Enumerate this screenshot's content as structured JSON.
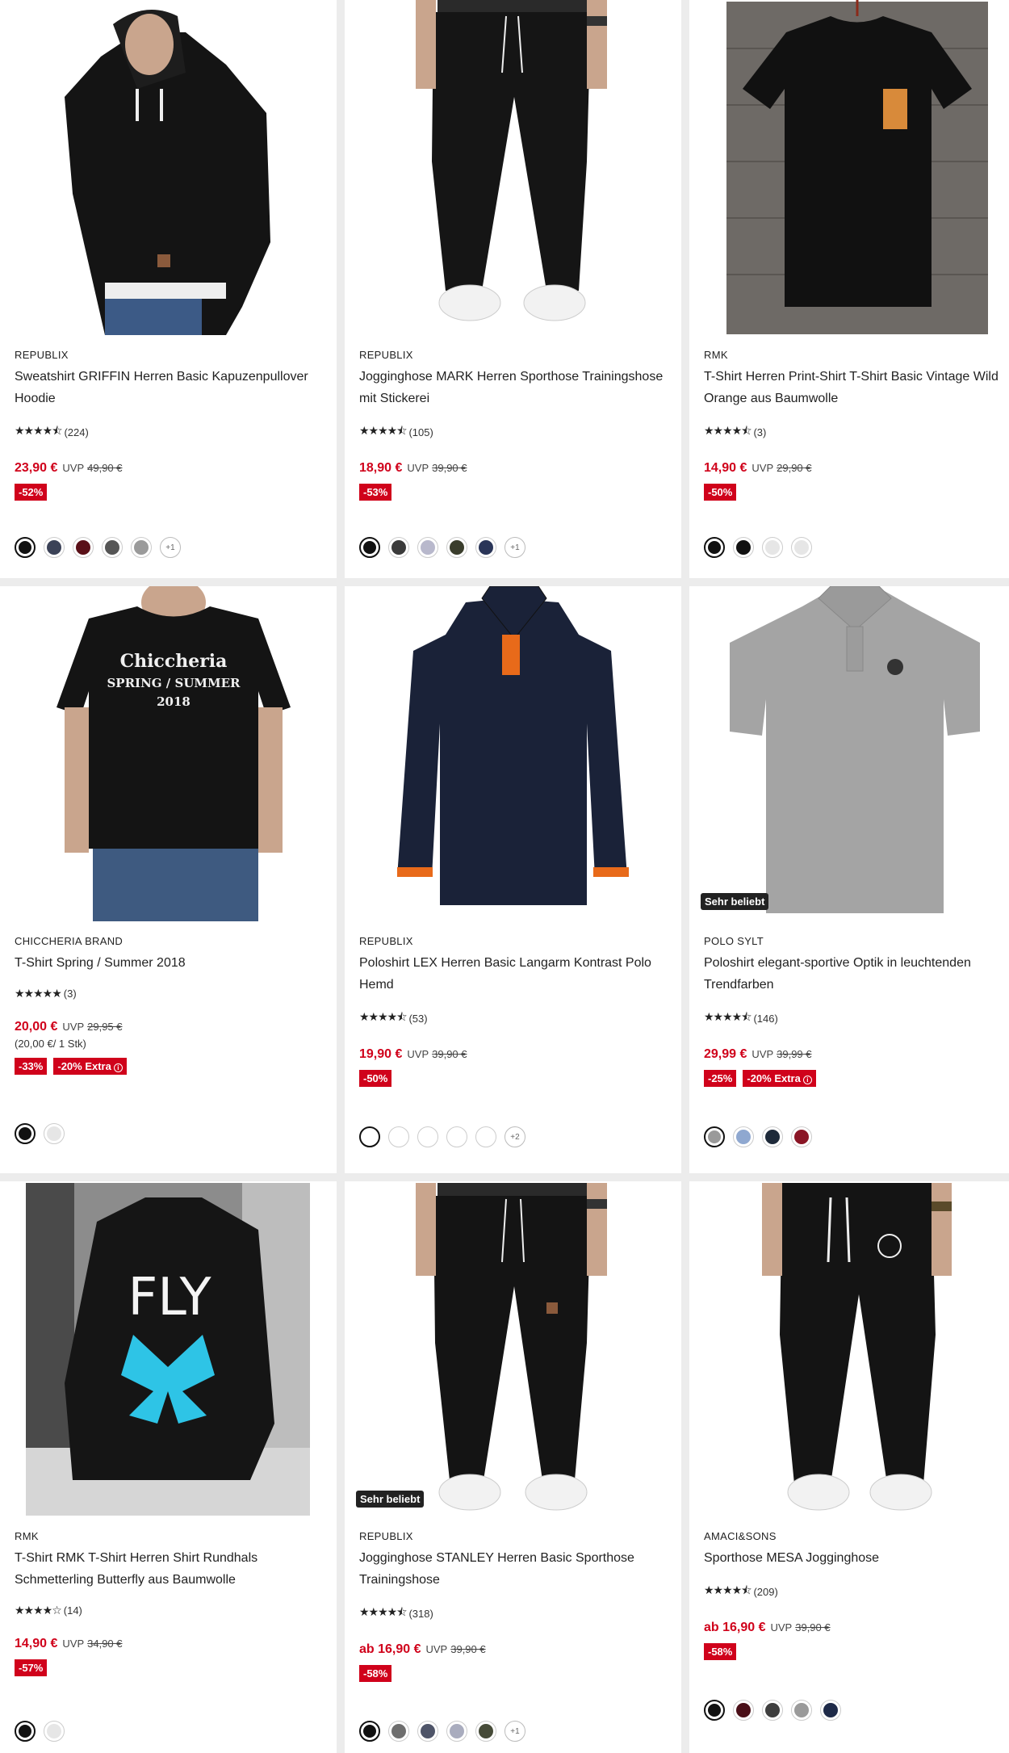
{
  "products": [
    {
      "brand": "REPUBLIX",
      "title": "Sweatshirt GRIFFIN Herren Basic Kapuzenpullover Hoodie",
      "stars": "★★★★⯪",
      "reviews": "(224)",
      "price": "23,90 €",
      "uvp": "UVP",
      "old_price": "49,90 €",
      "badges": [
        "-52%"
      ],
      "swatches": [
        "#111111",
        "#3b4257",
        "#5a1018",
        "#555555",
        "#9a9a9a"
      ],
      "more": "+1",
      "image": "black-hoodie"
    },
    {
      "brand": "REPUBLIX",
      "title": "Jogginghose MARK Herren Sporthose Trainingshose mit Stickerei",
      "stars": "★★★★⯪",
      "reviews": "(105)",
      "price": "18,90 €",
      "uvp": "UVP",
      "old_price": "39,90 €",
      "badges": [
        "-53%"
      ],
      "swatches": [
        "#111111",
        "#3a3a3a",
        "#b8b8cc",
        "#3a3d2c",
        "#2a3558"
      ],
      "more": "+1",
      "image": "black-jogging-pants"
    },
    {
      "brand": "RMK",
      "title": "T-Shirt Herren Print-Shirt T-Shirt Basic Vintage Wild Orange aus Baumwolle",
      "stars": "★★★★⯪",
      "reviews": "(3)",
      "price": "14,90 €",
      "uvp": "UVP",
      "old_price": "29,90 €",
      "badges": [
        "-50%"
      ],
      "swatches": [
        "#111111",
        "#111111",
        "#e6e6e6",
        "#e6e6e6"
      ],
      "more": "",
      "image": "black-tshirt-wood"
    },
    {
      "brand": "CHICCHERIA BRAND",
      "title": "T-Shirt Spring / Summer 2018",
      "stars": "★★★★★",
      "reviews": "(3)",
      "price": "20,00 €",
      "uvp": "UVP",
      "old_price": "29,95 €",
      "unit": "(20,00 €/ 1 Stk)",
      "badges": [
        "-33%",
        "-20% Extra"
      ],
      "swatches": [
        "#111111",
        "#e6e6e6"
      ],
      "more": "",
      "image": "black-tshirt-print",
      "print": [
        "Chiccheria",
        "SPRING / SUMMER",
        "2018"
      ]
    },
    {
      "brand": "REPUBLIX",
      "title": "Poloshirt LEX Herren Basic Langarm Kontrast Polo Hemd",
      "stars": "★★★★⯪",
      "reviews": "(53)",
      "price": "19,90 €",
      "uvp": "UVP",
      "old_price": "39,90 €",
      "badges": [
        "-50%"
      ],
      "swatches": [
        "#ffffff",
        "#ffffff",
        "#ffffff",
        "#ffffff",
        "#ffffff"
      ],
      "more": "+2",
      "image": "navy-polo-longsleeve"
    },
    {
      "brand": "POLO SYLT",
      "title": "Poloshirt elegant-sportive Optik in leuchtenden Trendfarben",
      "stars": "★★★★⯪",
      "reviews": "(146)",
      "price": "29,99 €",
      "uvp": "UVP",
      "old_price": "39,99 €",
      "badges": [
        "-25%",
        "-20% Extra"
      ],
      "swatches": [
        "#9a9a9a",
        "#8fa8d0",
        "#1e2a3a",
        "#8a1525"
      ],
      "more": "",
      "popular": "Sehr beliebt",
      "image": "grey-polo"
    },
    {
      "brand": "RMK",
      "title": "T-Shirt RMK T-Shirt Herren Shirt Rundhals Schmetterling Butterfly aus Baumwolle",
      "stars": "★★★★☆",
      "reviews": "(14)",
      "price": "14,90 €",
      "uvp": "UVP",
      "old_price": "34,90 €",
      "badges": [
        "-57%"
      ],
      "swatches": [
        "#111111",
        "#e6e6e6"
      ],
      "more": "",
      "image": "butterfly-tshirt",
      "print": [
        "FLY"
      ]
    },
    {
      "brand": "REPUBLIX",
      "title": "Jogginghose STANLEY Herren Basic Sporthose Trainingshose",
      "stars": "★★★★⯪",
      "reviews": "(318)",
      "price": "ab 16,90 €",
      "uvp": "UVP",
      "old_price": "39,90 €",
      "badges": [
        "-58%"
      ],
      "swatches": [
        "#111111",
        "#6e6e6e",
        "#4e5468",
        "#a9acbe",
        "#464b38"
      ],
      "more": "+1",
      "popular": "Sehr beliebt",
      "image": "black-jogging-pants-2"
    },
    {
      "brand": "AMACI&SONS",
      "title": "Sporthose MESA Jogginghose",
      "stars": "★★★★⯪",
      "reviews": "(209)",
      "price": "ab 16,90 €",
      "uvp": "UVP",
      "old_price": "39,90 €",
      "badges": [
        "-58%"
      ],
      "swatches": [
        "#111111",
        "#4a0f18",
        "#3e3e3e",
        "#9a9a9a",
        "#1e2a48"
      ],
      "more": "",
      "image": "black-jogging-pants-3"
    }
  ],
  "info_icon": "info-icon"
}
